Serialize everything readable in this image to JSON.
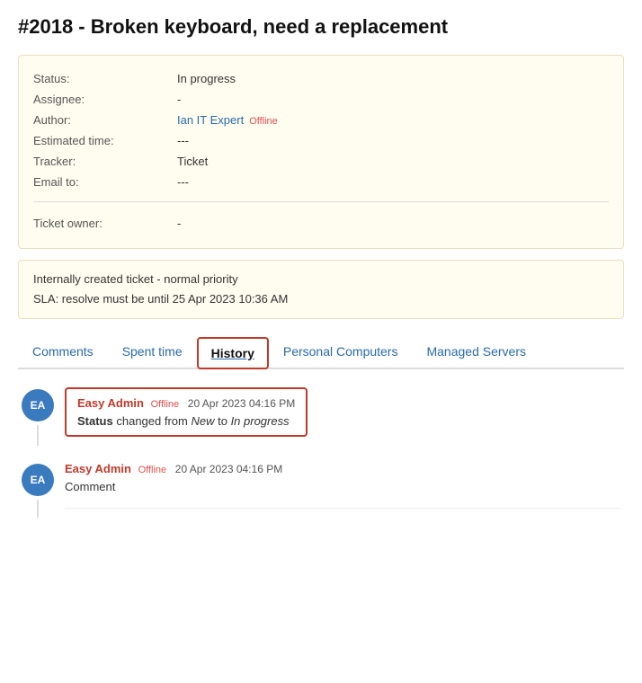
{
  "ticket": {
    "title": "#2018 - Broken keyboard, need a replacement",
    "status_label": "Status:",
    "status_value": "In progress",
    "assignee_label": "Assignee:",
    "assignee_value": "-",
    "author_label": "Author:",
    "author_name": "Ian IT Expert",
    "author_status": "Offline",
    "estimated_label": "Estimated time:",
    "estimated_value": "---",
    "tracker_label": "Tracker:",
    "tracker_value": "Ticket",
    "email_label": "Email to:",
    "email_value": "---",
    "owner_label": "Ticket owner:",
    "owner_value": "-",
    "sla_line1": "Internally created ticket - normal priority",
    "sla_line2": "SLA: resolve must be until 25 Apr 2023 10:36 AM"
  },
  "tabs": [
    {
      "label": "Comments",
      "active": false
    },
    {
      "label": "Spent time",
      "active": false
    },
    {
      "label": "History",
      "active": true
    },
    {
      "label": "Personal Computers",
      "active": false
    },
    {
      "label": "Managed Servers",
      "active": false
    }
  ],
  "history": [
    {
      "avatar_initials": "EA",
      "author": "Easy Admin",
      "status": "Offline",
      "date": "20 Apr 2023 04:16 PM",
      "change_bold": "Status",
      "change_text_pre": "changed from ",
      "change_from": "New",
      "change_text_mid": " to ",
      "change_to": "In progress",
      "highlighted": true
    },
    {
      "avatar_initials": "EA",
      "author": "Easy Admin",
      "status": "Offline",
      "date": "20 Apr 2023 04:16 PM",
      "comment": "Comment",
      "highlighted": false
    }
  ],
  "colors": {
    "accent_red": "#c0392b",
    "link_blue": "#2a6aad",
    "avatar_blue": "#3a7abf",
    "offline_red": "#e05050",
    "bg_cream": "#fffdf0",
    "border_cream": "#e8e0c0"
  }
}
